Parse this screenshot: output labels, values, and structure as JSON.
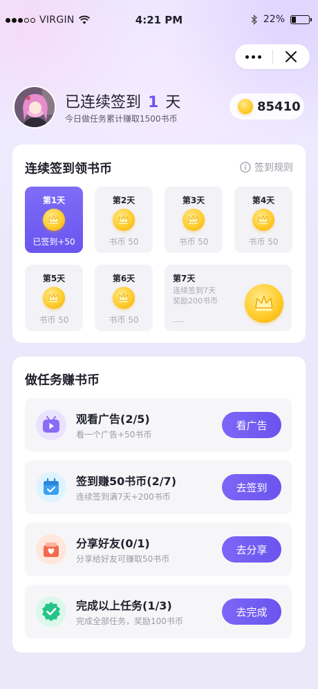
{
  "status_bar": {
    "carrier": "VIRGIN",
    "time": "4:21 PM",
    "battery": "22%",
    "battery_level": 0.22
  },
  "user": {
    "title_prefix": "已连续签到",
    "days": "1",
    "title_suffix": "天",
    "subtitle": "今日做任务累计赚取1500书币",
    "coins": "85410"
  },
  "signin": {
    "title": "连续签到领书币",
    "rules_label": "签到规则",
    "days": [
      {
        "label": "第1天",
        "reward": "已签到+50"
      },
      {
        "label": "第2天",
        "reward": "书币 50"
      },
      {
        "label": "第3天",
        "reward": "书币 50"
      },
      {
        "label": "第4天",
        "reward": "书币 50"
      },
      {
        "label": "第5天",
        "reward": "书币 50"
      },
      {
        "label": "第6天",
        "reward": "书币 50"
      }
    ],
    "day7": {
      "label": "第7天",
      "line1": "连续签到7天",
      "line2": "奖励200书币"
    }
  },
  "tasks": {
    "title": "做任务赚书币",
    "items": [
      {
        "name": "观看广告(2/5)",
        "desc": "看一个广告+50书币",
        "button": "看广告",
        "icon": "video-icon"
      },
      {
        "name": "签到赚50书币(2/7)",
        "desc": "连续签到满7天+200书币",
        "button": "去签到",
        "icon": "calendar-icon"
      },
      {
        "name": "分享好友(0/1)",
        "desc": "分享给好友可赚取50书币",
        "button": "去分享",
        "icon": "gift-icon"
      },
      {
        "name": "完成以上任务(1/3)",
        "desc": "完成全部任务，奖励100书币",
        "button": "去完成",
        "icon": "badge-check-icon"
      }
    ]
  },
  "colors": {
    "accent": "#6a55ee",
    "coin": "#ffcd2e"
  }
}
